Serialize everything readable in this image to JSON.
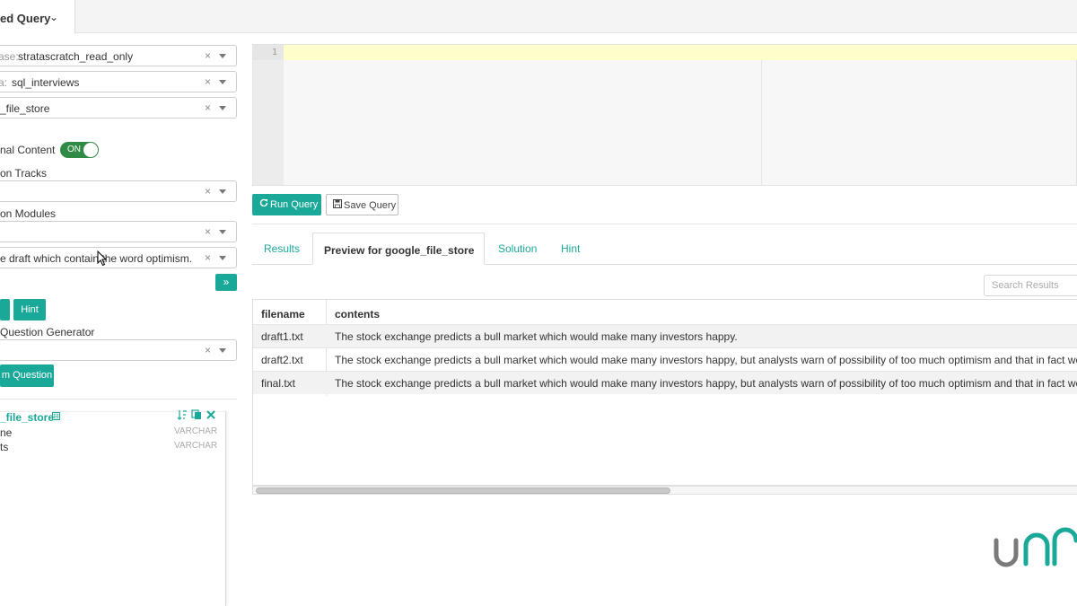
{
  "topbar": {
    "tab_label": "ed Query",
    "caret": "⌄"
  },
  "left_panel": {
    "database": {
      "prefix": "ase:",
      "value": "stratascratch_read_only"
    },
    "schema": {
      "prefix": "a:",
      "value": "sql_interviews"
    },
    "table": {
      "value": "_file_store"
    },
    "additional_content": {
      "label": "nal Content",
      "toggle_text": "ON"
    },
    "tracks_label": "on Tracks",
    "modules_label": "on Modules",
    "question": {
      "value": "e draft which contain the word optimism."
    },
    "go_button": "»",
    "hint_button": "Hint",
    "generator_label": "Question Generator",
    "random_question_button": "m Question",
    "clear_glyph": "×",
    "schema_tree": {
      "table": "_file_store",
      "collapse_glyph": "⊟",
      "columns": [
        {
          "name": "ne",
          "type": "VARCHAR"
        },
        {
          "name": "ts",
          "type": "VARCHAR"
        }
      ]
    }
  },
  "editor": {
    "line_number": "1"
  },
  "buttons": {
    "run_query": "Run Query",
    "save_query": "Save Query"
  },
  "tabs": [
    {
      "label": "Results"
    },
    {
      "label": "Preview for google_file_store"
    },
    {
      "label": "Solution"
    },
    {
      "label": "Hint"
    }
  ],
  "search": {
    "placeholder": "Search Results"
  },
  "results_table": {
    "headers": [
      "filename",
      "contents"
    ],
    "rows": [
      {
        "filename": "draft1.txt",
        "contents": "The stock exchange predicts a bull market which would make many investors happy."
      },
      {
        "filename": "draft2.txt",
        "contents": "The stock exchange predicts a bull market which would make many investors happy, but analysts warn of possibility of too much optimism and that in fact we a"
      },
      {
        "filename": "final.txt",
        "contents": "The stock exchange predicts a bull market which would make many investors happy, but analysts warn of possibility of too much optimism and that in fact we a"
      }
    ]
  },
  "colors": {
    "accent": "#1aa898",
    "toggle_on": "#2e8a44",
    "editor_active_line": "#ffffcc",
    "logo_gray": "#7a7a7a"
  }
}
